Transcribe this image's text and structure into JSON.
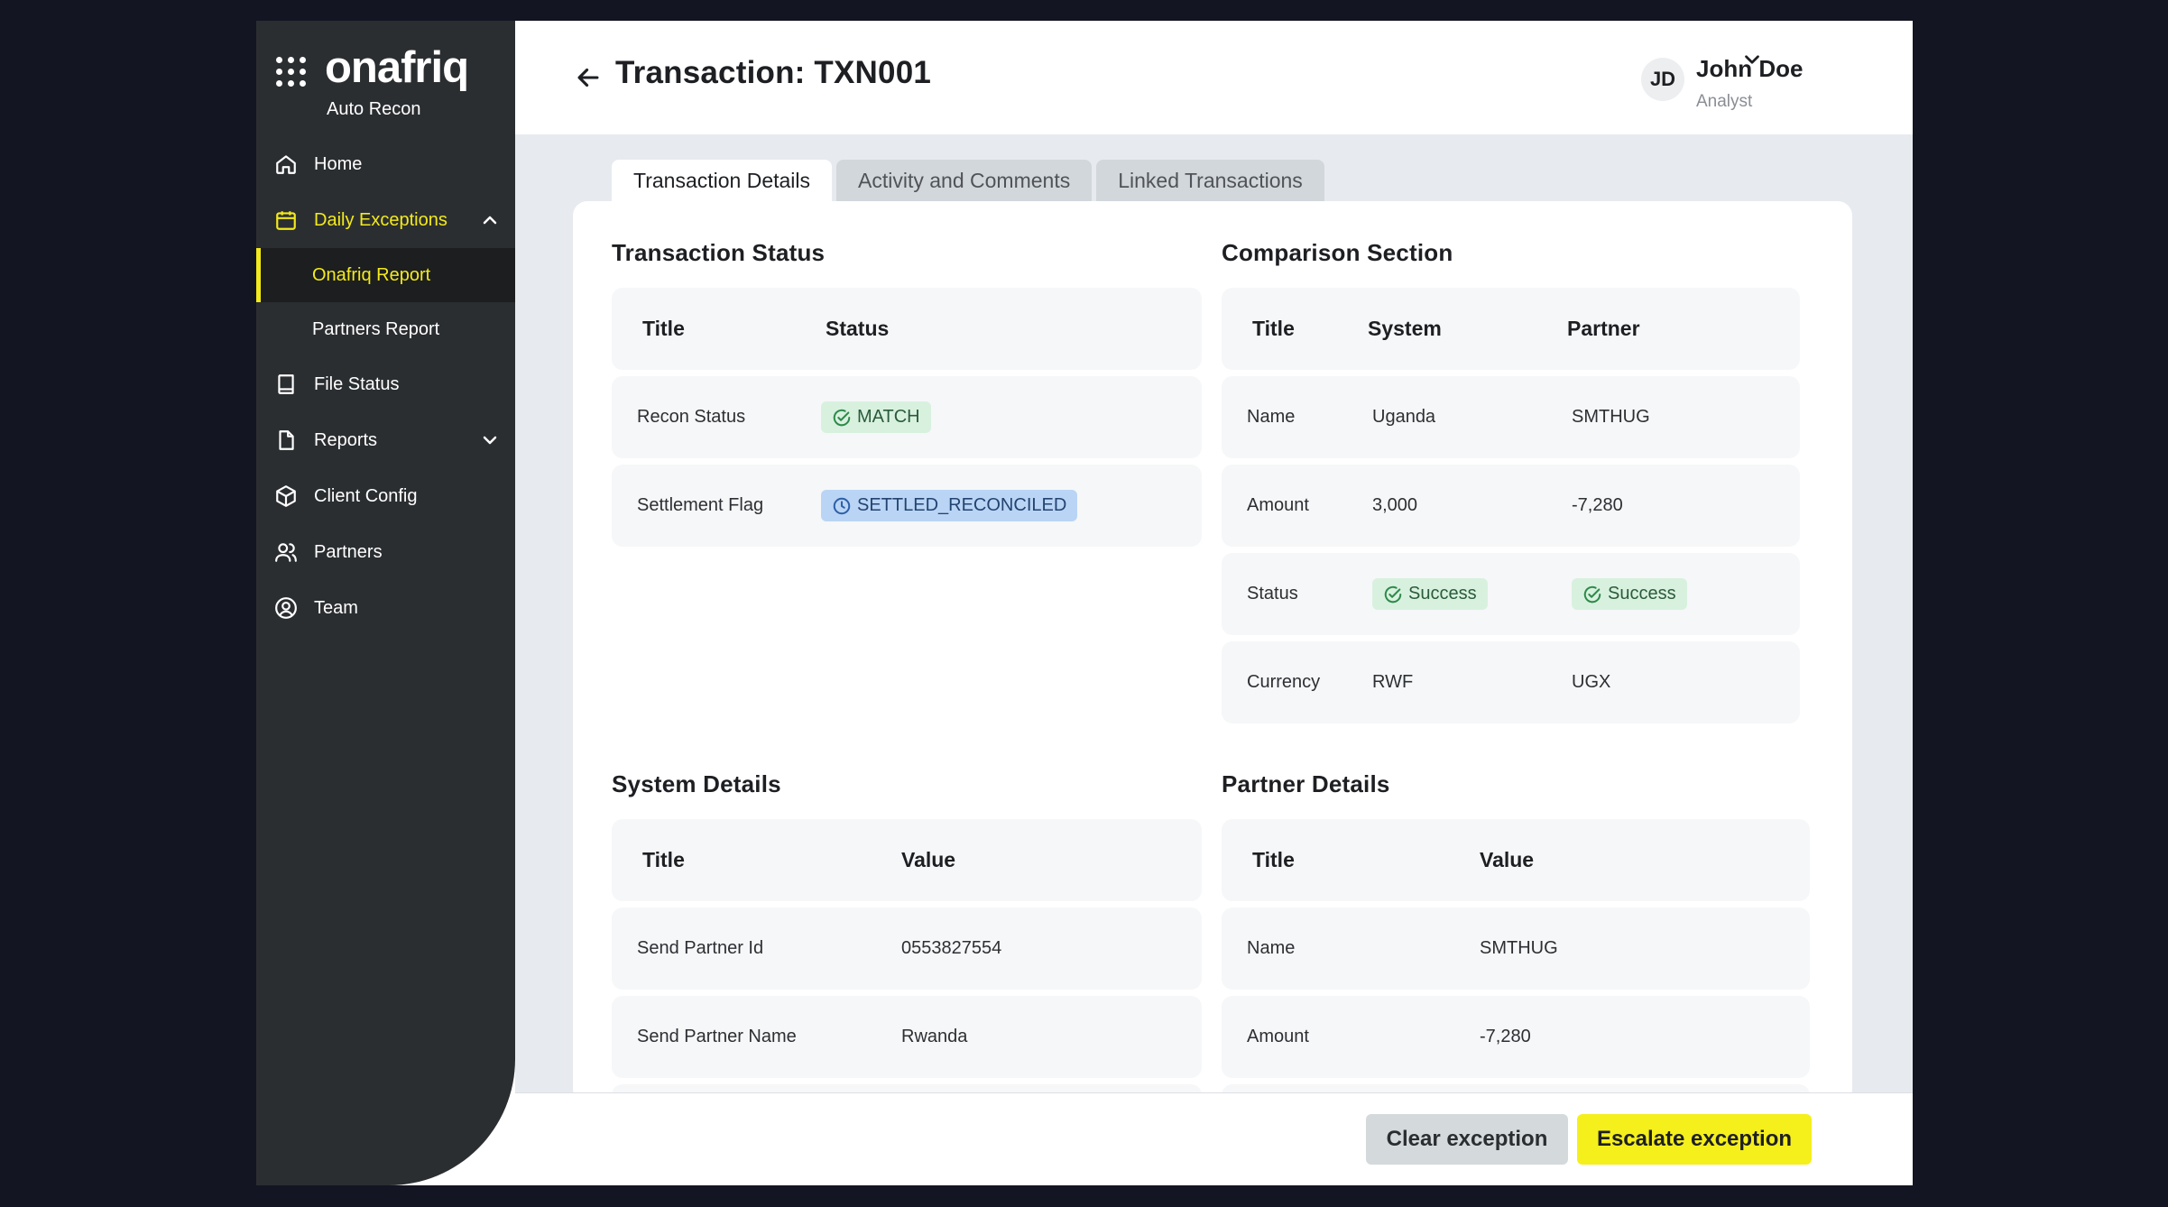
{
  "app": {
    "brand": "onafriq",
    "tagline": "Auto Recon"
  },
  "sidebar": {
    "items": [
      {
        "label": "Home",
        "icon": "home-icon"
      },
      {
        "label": "Daily Exceptions",
        "icon": "calendar-icon",
        "expanded": true
      },
      {
        "label": "File Status",
        "icon": "book-icon"
      },
      {
        "label": "Reports",
        "icon": "file-icon"
      },
      {
        "label": "Client Config",
        "icon": "cube-icon"
      },
      {
        "label": "Partners",
        "icon": "users-icon"
      },
      {
        "label": "Team",
        "icon": "user-circle-icon"
      }
    ],
    "subitems": [
      {
        "label": "Onafriq Report",
        "active": true
      },
      {
        "label": "Partners Report",
        "active": false
      }
    ]
  },
  "header": {
    "title": "Transaction: TXN001",
    "user": {
      "initials": "JD",
      "name": "John Doe",
      "role": "Analyst"
    }
  },
  "tabs": [
    {
      "label": "Transaction Details",
      "active": true
    },
    {
      "label": "Activity and Comments",
      "active": false
    },
    {
      "label": "Linked Transactions",
      "active": false
    }
  ],
  "transaction_status": {
    "title": "Transaction Status",
    "headers": [
      "Title",
      "Status"
    ],
    "rows": [
      {
        "title": "Recon Status",
        "status": "MATCH"
      },
      {
        "title": "Settlement Flag",
        "status": "SETTLED_RECONCILED"
      }
    ]
  },
  "comparison": {
    "title": "Comparison Section",
    "headers": [
      "Title",
      "System",
      "Partner"
    ],
    "rows": [
      {
        "title": "Name",
        "system": "Uganda",
        "partner": "SMTHUG"
      },
      {
        "title": "Amount",
        "system": "3,000",
        "partner": "-7,280"
      },
      {
        "title": "Status",
        "system": "Success",
        "partner": "Success"
      },
      {
        "title": "Currency",
        "system": "RWF",
        "partner": "UGX"
      }
    ]
  },
  "system_details": {
    "title": "System Details",
    "headers": [
      "Title",
      "Value"
    ],
    "rows": [
      {
        "title": "Send Partner Id",
        "value": "0553827554"
      },
      {
        "title": "Send Partner Name",
        "value": "Rwanda"
      }
    ]
  },
  "partner_details": {
    "title": "Partner Details",
    "headers": [
      "Title",
      "Value"
    ],
    "rows": [
      {
        "title": "Name",
        "value": "SMTHUG"
      },
      {
        "title": "Amount",
        "value": "-7,280"
      }
    ]
  },
  "footer": {
    "clear_label": "Clear exception",
    "escalate_label": "Escalate exception"
  },
  "colors": {
    "accent": "#f3ea1b",
    "sidebar": "#2b2e31",
    "success_bg": "#d8f1df",
    "info_bg": "#b9d4f5"
  }
}
